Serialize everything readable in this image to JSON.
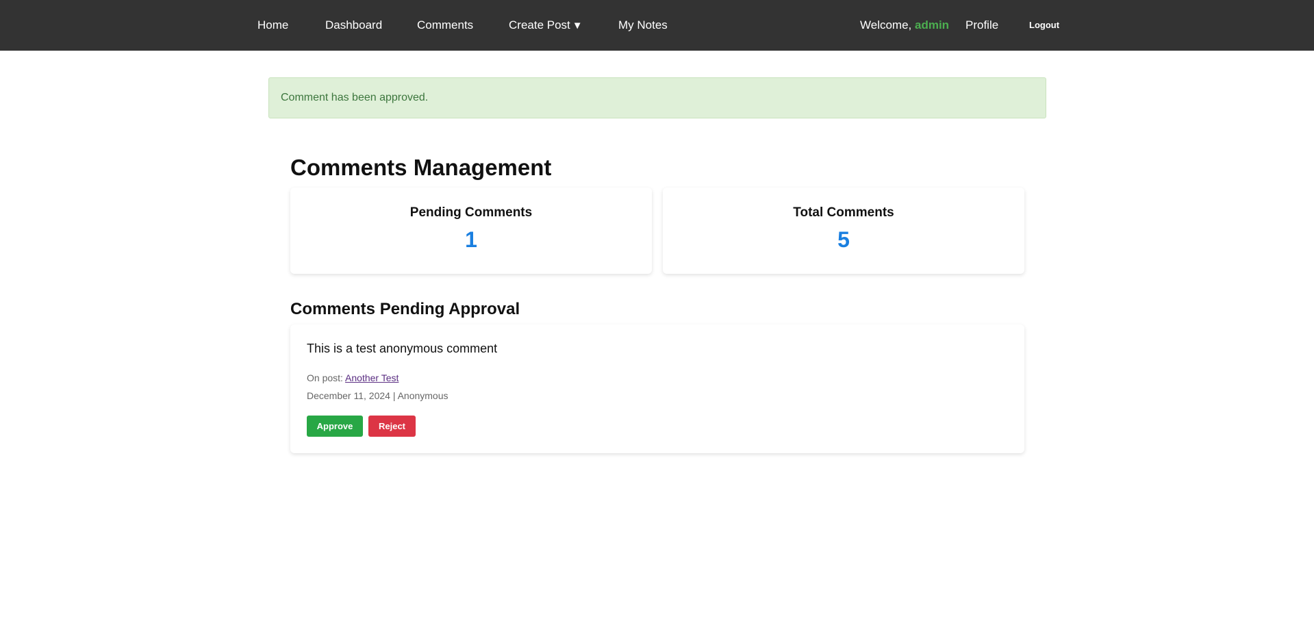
{
  "nav": {
    "items": [
      {
        "label": "Home"
      },
      {
        "label": "Dashboard"
      },
      {
        "label": "Comments"
      },
      {
        "label": "Create Post"
      },
      {
        "label": "My Notes"
      }
    ],
    "caret": "▼",
    "welcome_prefix": "Welcome, ",
    "username": "admin",
    "profile": "Profile",
    "logout": "Logout"
  },
  "alert": {
    "message": "Comment has been approved."
  },
  "page": {
    "title": "Comments Management"
  },
  "stats": [
    {
      "label": "Pending Comments",
      "value": "1"
    },
    {
      "label": "Total Comments",
      "value": "5"
    }
  ],
  "pending": {
    "title": "Comments Pending Approval",
    "comments": [
      {
        "text": "This is a test anonymous comment",
        "post_prefix": "On post: ",
        "post_title": "Another Test",
        "meta": "December 11, 2024 | Anonymous",
        "approve": "Approve",
        "reject": "Reject"
      }
    ]
  },
  "colors": {
    "navbar": "#333333",
    "accent_user": "#4caf50",
    "stat_value": "#1a7fe0",
    "alert_bg": "#dff0d8",
    "approve": "#28a745",
    "reject": "#dc3545"
  }
}
